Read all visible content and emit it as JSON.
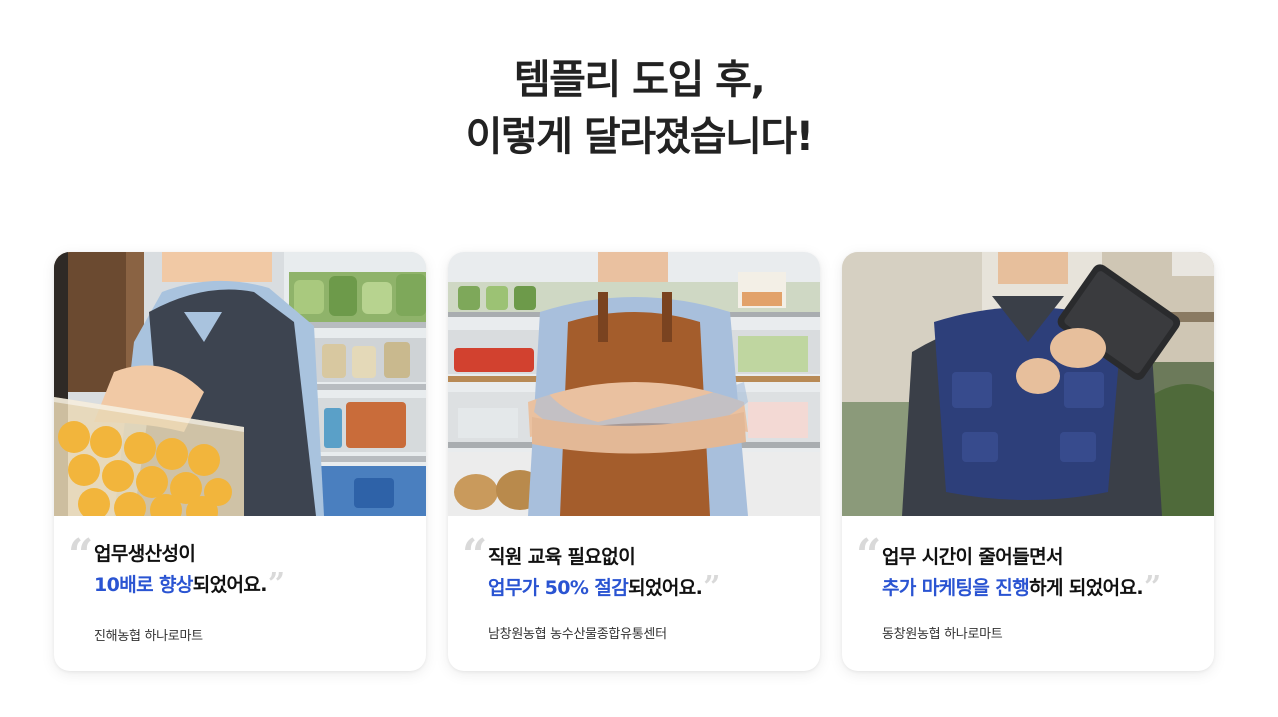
{
  "headline": {
    "line1": "템플리 도입 후,",
    "line2": "이렇게 달라졌습니다!"
  },
  "accent_color": "#2a54d2",
  "testimonials": [
    {
      "photo_subject": "smiling-worker-holding-fruit-crate",
      "line1_plain": "업무생산성이",
      "line2_highlight": "10배로 향상",
      "line2_plain": "되었어요.",
      "source": "진해농협 하나로마트"
    },
    {
      "photo_subject": "worker-in-apron-arms-crossed",
      "line1_plain": "직원 교육 필요없이",
      "line2_highlight": "업무가 50% 절감",
      "line2_plain": "되었어요.",
      "source": "남창원농협 농수산물종합유통센터"
    },
    {
      "photo_subject": "worker-in-vest-holding-tablet",
      "line1_plain": "업무 시간이 줄어들면서",
      "line2_highlight": "추가 마케팅을 진행",
      "line2_plain": "하게 되었어요.",
      "source": "동창원농협 하나로마트"
    }
  ],
  "quote_marks": {
    "open": "“",
    "close": "”"
  }
}
